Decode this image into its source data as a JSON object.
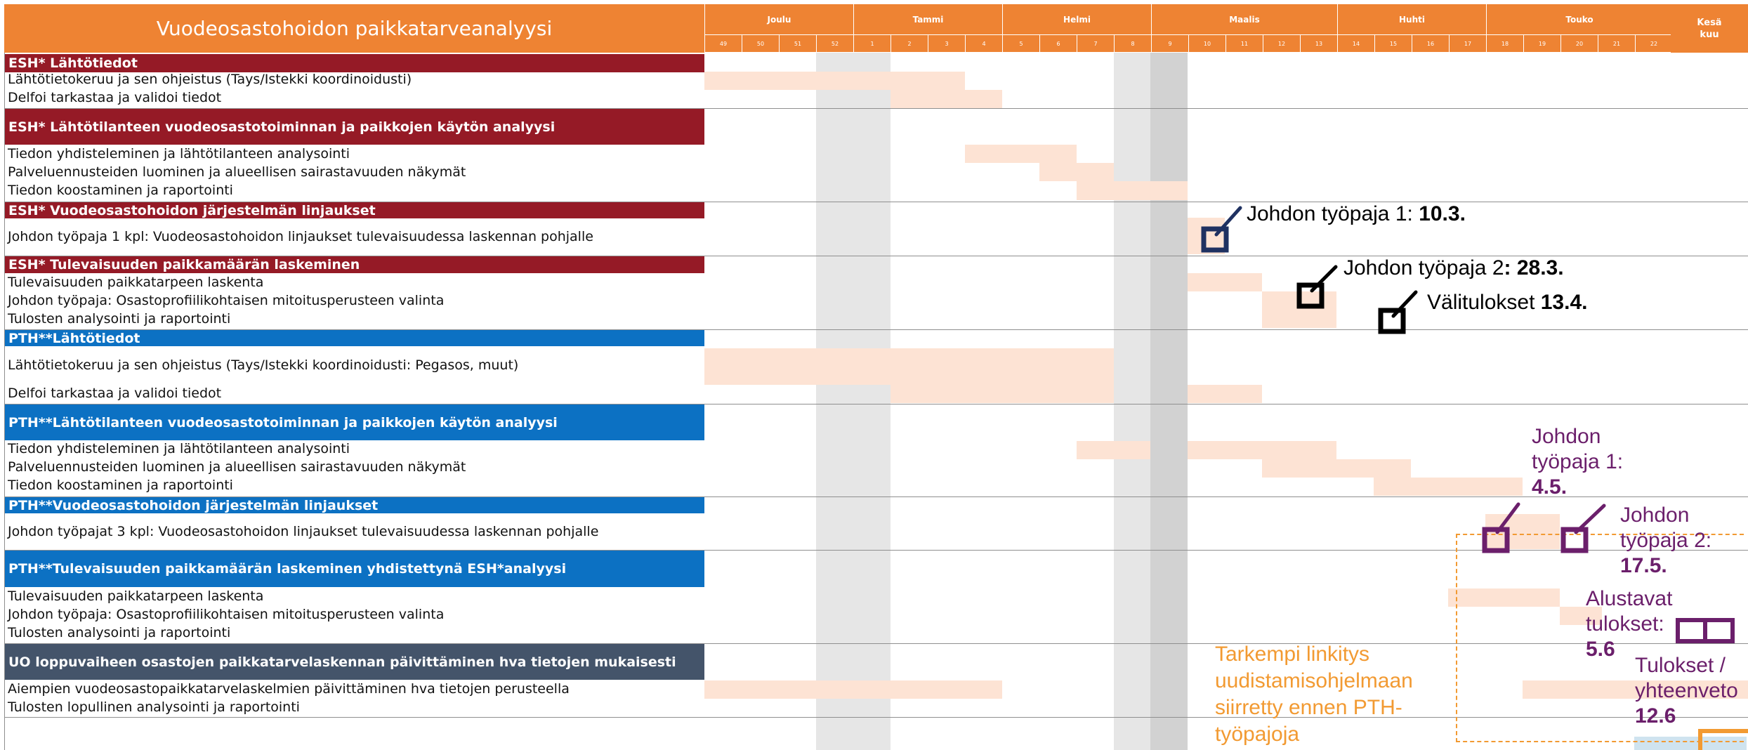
{
  "title": "Vuodeosastohoidon paikkatarveanalyysi",
  "months": [
    "Joulu",
    "Tammi",
    "Helmi",
    "Maalis",
    "Huhti",
    "Touko"
  ],
  "last_month": [
    "Kesä",
    "kuu"
  ],
  "weeks": [
    "49",
    "50",
    "51",
    "52",
    "1",
    "2",
    "3",
    "4",
    "5",
    "6",
    "7",
    "8",
    "9",
    "10",
    "11",
    "12",
    "13",
    "14",
    "15",
    "16",
    "17",
    "18",
    "19",
    "20",
    "21",
    "22"
  ],
  "sections": {
    "esh_lahtotiedot": "ESH* Lähtötiedot",
    "esh_analyysi": "ESH* Lähtötilanteen vuodeosastotoiminnan ja paikkojen käytön analyysi",
    "esh_linjaukset": "ESH* Vuodeosastohoidon järjestelmän linjaukset",
    "esh_laskeminen": "ESH* Tulevaisuuden paikkamäärän laskeminen",
    "pth_lahtotiedot": "PTH**Lähtötiedot",
    "pth_analyysi": "PTH**Lähtötilanteen vuodeosastotoiminnan ja paikkojen käytön analyysi",
    "pth_linjaukset": "PTH**Vuodeosastohoidon järjestelmän linjaukset",
    "pth_laskeminen": "PTH**Tulevaisuuden paikkamäärän laskeminen yhdistettynä ESH*analyysi",
    "uo": "UO loppuvaiheen osastojen paikkatarvelaskennan päivittäminen hva tietojen mukaisesti"
  },
  "tasks": {
    "r1": "Lähtötietokeruu ja sen ohjeistus (Tays/Istekki koordinoidusti)",
    "r2": "Delfoi tarkastaa ja validoi tiedot",
    "r3": "Tiedon yhdisteleminen ja lähtötilanteen analysointi",
    "r4": "Palveluennusteiden luominen ja alueellisen sairastavuuden näkymät",
    "r5": "Tiedon koostaminen ja raportointi",
    "r6": "Johdon työpaja 1 kpl: Vuodeosastohoidon linjaukset tulevaisuudessa laskennan pohjalle",
    "r7": "Tulevaisuuden paikkatarpeen laskenta",
    "r8": "Johdon työpaja: Osastoprofiilikohtaisen mitoitusperusteen valinta",
    "r9": "Tulosten analysointi ja raportointi",
    "r10": "Lähtötietokeruu ja sen ohjeistus (Tays/Istekki koordinoidusti: Pegasos, muut)",
    "r11": "Delfoi tarkastaa ja validoi tiedot",
    "r12": "Tiedon yhdisteleminen ja lähtötilanteen analysointi",
    "r13": "Palveluennusteiden luominen ja alueellisen sairastavuuden näkymät",
    "r14": "Tiedon koostaminen ja raportointi",
    "r15": "Johdon työpajat 3 kpl: Vuodeosastohoidon linjaukset tulevaisuudessa laskennan pohjalle",
    "r16": "Tulevaisuuden paikkatarpeen laskenta",
    "r17": "Johdon työpaja: Osastoprofiilikohtaisen mitoitusperusteen valinta",
    "r18": "Tulosten analysointi ja raportointi",
    "r19": "Aiempien vuodeosastopaikkatarvelaskelmien päivittäminen hva tietojen perusteella",
    "r20": "Tulosten lopullinen analysointi ja raportointi"
  },
  "milestones": {
    "m1": {
      "label": "Johdon työpaja 1: ",
      "date": "10.3."
    },
    "m2": {
      "label": "Johdon työpaja 2",
      "date": ": 28.3."
    },
    "m3": {
      "label": "Välitulokset ",
      "date": "13.4."
    },
    "m4": {
      "label1": "Johdon",
      "label2": "työpaja 1:",
      "date": "4.5."
    },
    "m5": {
      "label1": "Johdon",
      "label2": "työpaja 2:",
      "date": "17.5."
    },
    "m6": {
      "label1": "Alustavat",
      "label2": "tulokset:",
      "date": "5.6"
    },
    "m7": {
      "label1": "Tulokset /",
      "label2": "yhteenveto",
      "date": "12.6"
    }
  },
  "note": [
    "Tarkempi linkitys",
    "uudistamisohjelmaan",
    "siirretty ennen PTH-",
    "työpajoja"
  ],
  "colors": {
    "orange": "#ee8333",
    "esh_red": "#951a26",
    "pth_blue": "#0c71c3",
    "uo_slate": "#44546a",
    "bar": "#fde3d4",
    "navy": "#1f3161",
    "purple": "#6b1f6b",
    "note_orange": "#f29a32"
  }
}
